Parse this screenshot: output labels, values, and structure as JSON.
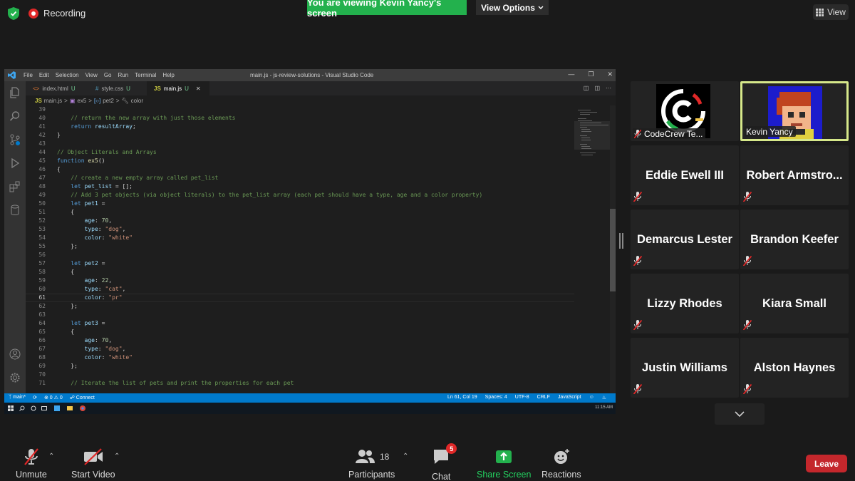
{
  "meeting": {
    "recording_label": "Recording",
    "viewing_banner": "You are viewing Kevin Yancy's screen",
    "view_options_label": "View Options",
    "view_label": "View"
  },
  "vscode": {
    "menu": [
      "File",
      "Edit",
      "Selection",
      "View",
      "Go",
      "Run",
      "Terminal",
      "Help"
    ],
    "window_title": "main.js - js-review-solutions - Visual Studio Code",
    "tabs": [
      {
        "icon": "<>",
        "name": "index.html",
        "status": "U"
      },
      {
        "icon": "#",
        "name": "style.css",
        "status": "U"
      },
      {
        "icon": "JS",
        "name": "main.js",
        "status": "U",
        "active": true
      }
    ],
    "breadcrumb": [
      "JS",
      "main.js",
      ">",
      "ex5",
      ">",
      "pet2",
      ">",
      "color"
    ],
    "lines": [
      {
        "n": "39",
        "t": [
          {
            "c": "",
            "s": ""
          }
        ]
      },
      {
        "n": "40",
        "t": [
          {
            "c": "",
            "s": "    "
          },
          {
            "c": "c-com",
            "s": "// return the new array with just those elements"
          }
        ]
      },
      {
        "n": "41",
        "t": [
          {
            "c": "",
            "s": "    "
          },
          {
            "c": "c-kw",
            "s": "return"
          },
          {
            "c": "",
            "s": " "
          },
          {
            "c": "c-var",
            "s": "resultArray"
          },
          {
            "c": "",
            "s": ";"
          }
        ]
      },
      {
        "n": "42",
        "t": [
          {
            "c": "",
            "s": "}"
          }
        ]
      },
      {
        "n": "43",
        "t": [
          {
            "c": "",
            "s": ""
          }
        ]
      },
      {
        "n": "44",
        "t": [
          {
            "c": "c-com",
            "s": "// Object Literals and Arrays"
          }
        ]
      },
      {
        "n": "45",
        "t": [
          {
            "c": "c-kw",
            "s": "function"
          },
          {
            "c": "",
            "s": " "
          },
          {
            "c": "c-fn",
            "s": "ex5"
          },
          {
            "c": "",
            "s": "()"
          }
        ]
      },
      {
        "n": "46",
        "t": [
          {
            "c": "",
            "s": "{"
          }
        ]
      },
      {
        "n": "47",
        "t": [
          {
            "c": "",
            "s": "    "
          },
          {
            "c": "c-com",
            "s": "// create a new empty array called pet_list"
          }
        ]
      },
      {
        "n": "48",
        "t": [
          {
            "c": "",
            "s": "    "
          },
          {
            "c": "c-kw",
            "s": "let"
          },
          {
            "c": "",
            "s": " "
          },
          {
            "c": "c-var",
            "s": "pet_list"
          },
          {
            "c": "",
            "s": " = [];"
          }
        ]
      },
      {
        "n": "49",
        "t": [
          {
            "c": "",
            "s": "    "
          },
          {
            "c": "c-com",
            "s": "// Add 3 pet objects (via object literals) to the pet_list array (each pet should have a type, age and a color property)"
          }
        ]
      },
      {
        "n": "50",
        "t": [
          {
            "c": "",
            "s": "    "
          },
          {
            "c": "c-kw",
            "s": "let"
          },
          {
            "c": "",
            "s": " "
          },
          {
            "c": "c-var",
            "s": "pet1"
          },
          {
            "c": "",
            "s": " ="
          }
        ]
      },
      {
        "n": "51",
        "t": [
          {
            "c": "",
            "s": "    {"
          }
        ]
      },
      {
        "n": "52",
        "t": [
          {
            "c": "",
            "s": "        "
          },
          {
            "c": "c-var",
            "s": "age"
          },
          {
            "c": "",
            "s": ": "
          },
          {
            "c": "c-num",
            "s": "70"
          },
          {
            "c": "",
            "s": ","
          }
        ]
      },
      {
        "n": "53",
        "t": [
          {
            "c": "",
            "s": "        "
          },
          {
            "c": "c-var",
            "s": "type"
          },
          {
            "c": "",
            "s": ": "
          },
          {
            "c": "c-str",
            "s": "\"dog\""
          },
          {
            "c": "",
            "s": ","
          }
        ]
      },
      {
        "n": "54",
        "t": [
          {
            "c": "",
            "s": "        "
          },
          {
            "c": "c-var",
            "s": "color"
          },
          {
            "c": "",
            "s": ": "
          },
          {
            "c": "c-str",
            "s": "\"white\""
          }
        ]
      },
      {
        "n": "55",
        "t": [
          {
            "c": "",
            "s": "    };"
          }
        ]
      },
      {
        "n": "56",
        "t": [
          {
            "c": "",
            "s": ""
          }
        ]
      },
      {
        "n": "57",
        "t": [
          {
            "c": "",
            "s": "    "
          },
          {
            "c": "c-kw",
            "s": "let"
          },
          {
            "c": "",
            "s": " "
          },
          {
            "c": "c-var",
            "s": "pet2"
          },
          {
            "c": "",
            "s": " ="
          }
        ]
      },
      {
        "n": "58",
        "t": [
          {
            "c": "",
            "s": "    {"
          }
        ]
      },
      {
        "n": "59",
        "t": [
          {
            "c": "",
            "s": "        "
          },
          {
            "c": "c-var",
            "s": "age"
          },
          {
            "c": "",
            "s": ": "
          },
          {
            "c": "c-num",
            "s": "22"
          },
          {
            "c": "",
            "s": ","
          }
        ]
      },
      {
        "n": "60",
        "t": [
          {
            "c": "",
            "s": "        "
          },
          {
            "c": "c-var",
            "s": "type"
          },
          {
            "c": "",
            "s": ": "
          },
          {
            "c": "c-str",
            "s": "\"cat\""
          },
          {
            "c": "",
            "s": ","
          }
        ]
      },
      {
        "n": "61",
        "t": [
          {
            "c": "",
            "s": "        "
          },
          {
            "c": "c-var",
            "s": "color"
          },
          {
            "c": "",
            "s": ": "
          },
          {
            "c": "c-str",
            "s": "\"pr\""
          }
        ],
        "current": true
      },
      {
        "n": "62",
        "t": [
          {
            "c": "",
            "s": "    };"
          }
        ]
      },
      {
        "n": "63",
        "t": [
          {
            "c": "",
            "s": ""
          }
        ]
      },
      {
        "n": "64",
        "t": [
          {
            "c": "",
            "s": "    "
          },
          {
            "c": "c-kw",
            "s": "let"
          },
          {
            "c": "",
            "s": " "
          },
          {
            "c": "c-var",
            "s": "pet3"
          },
          {
            "c": "",
            "s": " ="
          }
        ]
      },
      {
        "n": "65",
        "t": [
          {
            "c": "",
            "s": "    {"
          }
        ]
      },
      {
        "n": "66",
        "t": [
          {
            "c": "",
            "s": "        "
          },
          {
            "c": "c-var",
            "s": "age"
          },
          {
            "c": "",
            "s": ": "
          },
          {
            "c": "c-num",
            "s": "70"
          },
          {
            "c": "",
            "s": ","
          }
        ]
      },
      {
        "n": "67",
        "t": [
          {
            "c": "",
            "s": "        "
          },
          {
            "c": "c-var",
            "s": "type"
          },
          {
            "c": "",
            "s": ": "
          },
          {
            "c": "c-str",
            "s": "\"dog\""
          },
          {
            "c": "",
            "s": ","
          }
        ]
      },
      {
        "n": "68",
        "t": [
          {
            "c": "",
            "s": "        "
          },
          {
            "c": "c-var",
            "s": "color"
          },
          {
            "c": "",
            "s": ": "
          },
          {
            "c": "c-str",
            "s": "\"white\""
          }
        ]
      },
      {
        "n": "69",
        "t": [
          {
            "c": "",
            "s": "    };"
          }
        ]
      },
      {
        "n": "70",
        "t": [
          {
            "c": "",
            "s": ""
          }
        ]
      },
      {
        "n": "71",
        "t": [
          {
            "c": "",
            "s": "    "
          },
          {
            "c": "c-com",
            "s": "// Iterate the list of pets and print the properties for each pet"
          }
        ]
      }
    ],
    "status_left": {
      "branch": "main*",
      "problems": "0",
      "warnings": "0",
      "connect": "Connect"
    },
    "status_right": [
      "Ln 61, Col 19",
      "Spaces: 4",
      "UTF-8",
      "CRLF",
      "JavaScript"
    ],
    "clock": "11:15 AM"
  },
  "participants": [
    {
      "name": "CodeCrew Te...",
      "muted": true,
      "video": true,
      "avatar": "codecrew-logo"
    },
    {
      "name": "Kevin Yancy",
      "muted": false,
      "video": true,
      "active_speaker": true,
      "avatar": "pixel-avatar"
    },
    {
      "name": "Eddie Ewell III",
      "muted": true
    },
    {
      "name": "Robert  Armstro...",
      "muted": true
    },
    {
      "name": "Demarcus Lester",
      "muted": true
    },
    {
      "name": "Brandon Keefer",
      "muted": true
    },
    {
      "name": "Lizzy Rhodes",
      "muted": true
    },
    {
      "name": "Kiara Small",
      "muted": true
    },
    {
      "name": "Justin Williams",
      "muted": true
    },
    {
      "name": "Alston Haynes",
      "muted": true
    }
  ],
  "controls": {
    "unmute": "Unmute",
    "start_video": "Start Video",
    "participants": "Participants",
    "participants_count": "18",
    "chat": "Chat",
    "chat_badge": "5",
    "share_screen": "Share Screen",
    "reactions": "Reactions",
    "leave": "Leave"
  },
  "colors": {
    "share_green": "#23b14d",
    "leave_red": "#c4272c",
    "vscode_blue": "#007acc",
    "active_border": "#d6e88a"
  }
}
